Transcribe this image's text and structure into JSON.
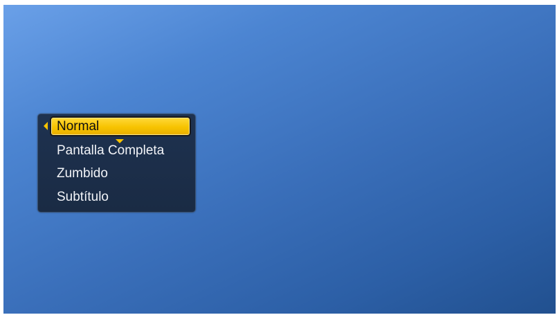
{
  "menu": {
    "items": [
      {
        "label": "Normal",
        "selected": true
      },
      {
        "label": "Pantalla Completa",
        "selected": false
      },
      {
        "label": "Zumbido",
        "selected": false
      },
      {
        "label": "Subtítulo",
        "selected": false
      }
    ]
  },
  "icons": {
    "left": "triangle-left-icon",
    "down": "triangle-down-icon"
  },
  "colors": {
    "background_light": "#6aa0e8",
    "background_dark": "#21508f",
    "menu_background": "#1a2b44",
    "highlight": "#f7c300",
    "text": "#f2f4f8",
    "selected_text": "#101010"
  }
}
